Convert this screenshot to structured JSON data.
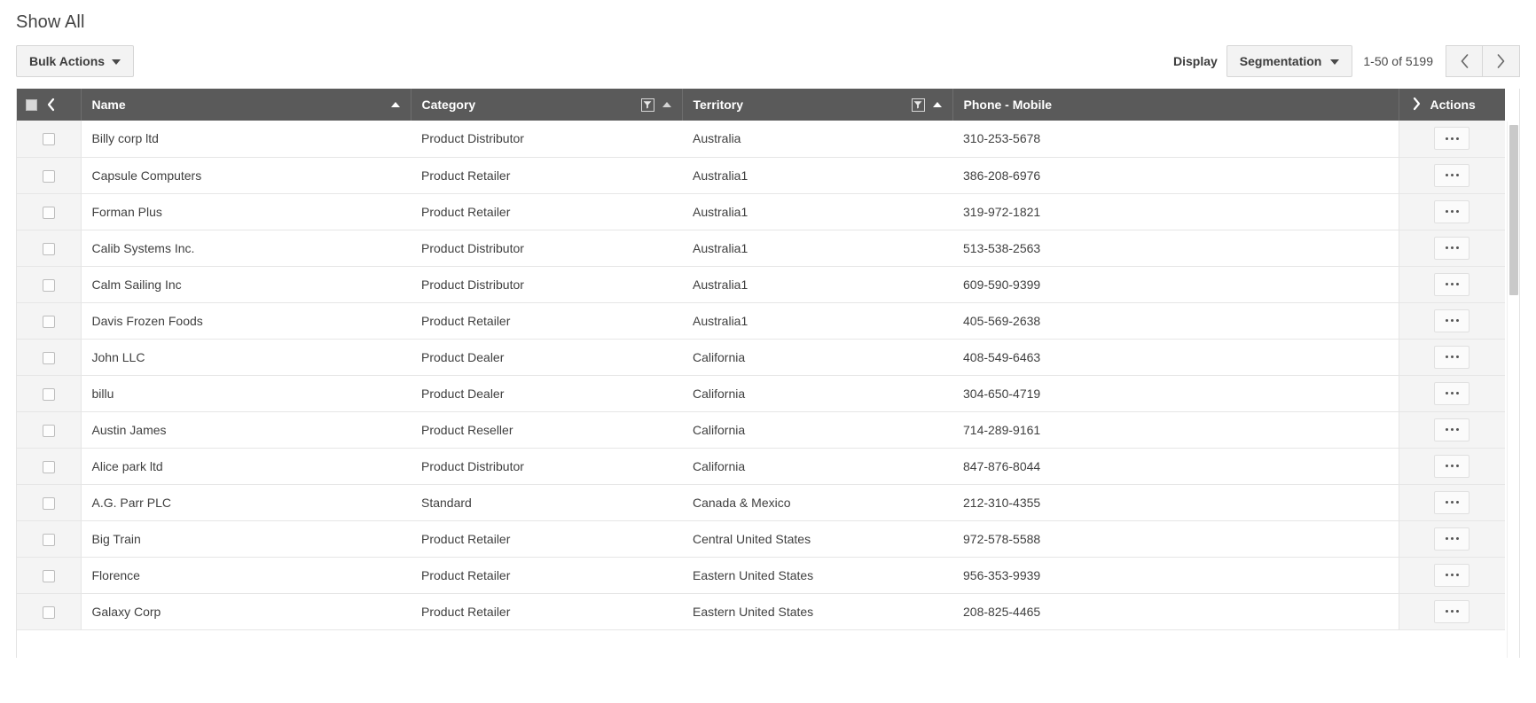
{
  "page": {
    "title": "Show All"
  },
  "toolbar": {
    "bulk_actions_label": "Bulk Actions",
    "display_label": "Display",
    "segmentation_label": "Segmentation",
    "range_text": "1-50 of 5199",
    "prev_icon": "chevron-left-icon",
    "next_icon": "chevron-right-icon",
    "dropdown_icon": "caret-down-icon"
  },
  "grid": {
    "select_all_icon": "select-all-checkbox-icon",
    "collapse_icon": "chevron-left-icon",
    "expand_icon": "chevron-right-icon",
    "filter_icon": "filter-funnel-icon",
    "sort_asc_icon": "sort-ascending-icon",
    "row_menu_icon": "ellipsis-icon",
    "columns": [
      {
        "key": "name",
        "label": "Name",
        "sortable": true,
        "sorted": "asc",
        "filter": false
      },
      {
        "key": "category",
        "label": "Category",
        "sortable": true,
        "sorted": "none",
        "filter": true
      },
      {
        "key": "territory",
        "label": "Territory",
        "sortable": true,
        "sorted": "asc",
        "filter": true
      },
      {
        "key": "phone",
        "label": "Phone - Mobile",
        "sortable": false,
        "sorted": "none",
        "filter": false
      }
    ],
    "actions_header": "Actions",
    "rows": [
      {
        "name": "Billy corp ltd",
        "category": "Product Distributor",
        "territory": "Australia",
        "phone": "310-253-5678"
      },
      {
        "name": "Capsule Computers",
        "category": "Product Retailer",
        "territory": "Australia1",
        "phone": "386-208-6976"
      },
      {
        "name": "Forman Plus",
        "category": "Product Retailer",
        "territory": "Australia1",
        "phone": "319-972-1821"
      },
      {
        "name": "Calib Systems Inc.",
        "category": "Product Distributor",
        "territory": "Australia1",
        "phone": "513-538-2563"
      },
      {
        "name": "Calm Sailing Inc",
        "category": "Product Distributor",
        "territory": "Australia1",
        "phone": "609-590-9399"
      },
      {
        "name": "Davis Frozen Foods",
        "category": "Product Retailer",
        "territory": "Australia1",
        "phone": "405-569-2638"
      },
      {
        "name": "John LLC",
        "category": "Product Dealer",
        "territory": "California",
        "phone": "408-549-6463"
      },
      {
        "name": "billu",
        "category": "Product Dealer",
        "territory": "California",
        "phone": "304-650-4719"
      },
      {
        "name": "Austin James",
        "category": "Product Reseller",
        "territory": "California",
        "phone": "714-289-9161"
      },
      {
        "name": "Alice park ltd",
        "category": "Product Distributor",
        "territory": "California",
        "phone": "847-876-8044"
      },
      {
        "name": "A.G. Parr PLC",
        "category": "Standard",
        "territory": "Canada & Mexico",
        "phone": "212-310-4355"
      },
      {
        "name": "Big Train",
        "category": "Product Retailer",
        "territory": "Central United States",
        "phone": "972-578-5588"
      },
      {
        "name": "Florence",
        "category": "Product Retailer",
        "territory": "Eastern United States",
        "phone": "956-353-9939"
      },
      {
        "name": "Galaxy Corp",
        "category": "Product Retailer",
        "territory": "Eastern United States",
        "phone": "208-825-4465"
      }
    ]
  },
  "colors": {
    "header_bg": "#5a5a5a",
    "header_text": "#ffffff",
    "body_text": "#3f3f3f",
    "gutter_bg": "#f4f4f4",
    "border": "#e6e6e6",
    "button_bg": "#f3f3f3"
  }
}
